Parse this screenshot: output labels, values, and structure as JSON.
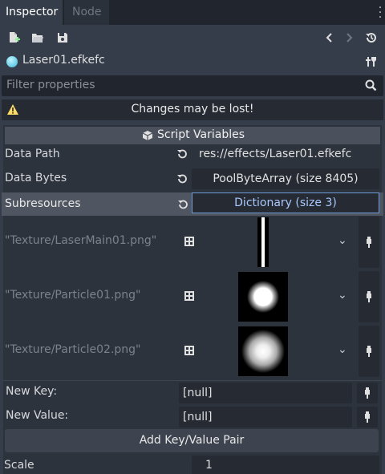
{
  "tabs": [
    {
      "label": "Inspector",
      "active": true
    },
    {
      "label": "Node",
      "active": false
    }
  ],
  "toolbar": {
    "icons": [
      "new-resource-icon",
      "open-folder-icon",
      "save-icon",
      "back-arrow-icon",
      "forward-arrow-icon",
      "history-icon"
    ]
  },
  "resource": {
    "name": "Laser01.efkefc"
  },
  "filter": {
    "placeholder": "Filter properties"
  },
  "warning": {
    "text": "Changes may be lost!"
  },
  "section": {
    "title": "Script Variables"
  },
  "properties": [
    {
      "label": "Data Path",
      "value": "res://effects/Laser01.efkefc"
    },
    {
      "label": "Data Bytes",
      "value": "PoolByteArray (size 8405)"
    },
    {
      "label": "Subresources",
      "value": "Dictionary (size 3)"
    }
  ],
  "textures": [
    {
      "key": "\"Texture/LaserMain01.png\"",
      "preview": "laser-beam"
    },
    {
      "key": "\"Texture/Particle01.png\"",
      "preview": "solid-dot"
    },
    {
      "key": "\"Texture/Particle02.png\"",
      "preview": "soft-dot"
    }
  ],
  "new_entry": {
    "key_label": "New Key:",
    "key_value": "[null]",
    "value_label": "New Value:",
    "value_value": "[null]",
    "add_button": "Add Key/Value Pair"
  },
  "scale": {
    "label": "Scale",
    "value": "1"
  },
  "colors": {
    "background": "#363d4a",
    "tabbar": "#21262e",
    "accent_border": "#6f9ad8",
    "accent_text": "#a8c8ff",
    "warning_icon": "#ffdd65"
  }
}
